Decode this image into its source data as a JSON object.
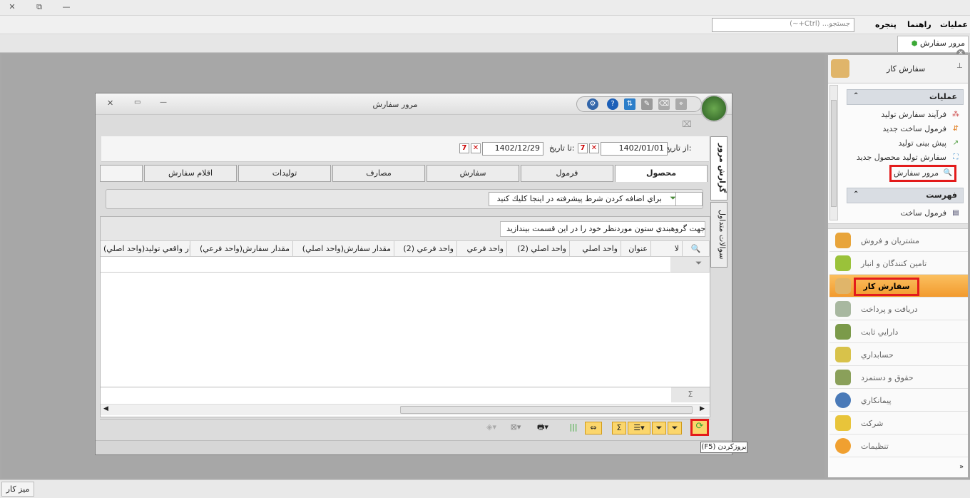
{
  "window": {
    "close": "✕",
    "restore": "⧉",
    "minimize": "—"
  },
  "menu": {
    "items": [
      "عملیات",
      "راهنما",
      "پنجره"
    ],
    "search_placeholder": "جستجو... (Ctrl+~)"
  },
  "doctab": {
    "label": "مرور سفارش"
  },
  "dialog": {
    "title": "مرور سفارش",
    "from_label": "از تاریخ:",
    "from_value": "1402/01/01",
    "to_label": "تا تاریخ:",
    "to_value": "1402/12/29",
    "tabs": [
      "محصول",
      "فرمول",
      "سفارش",
      "مصارف",
      "تولیدات",
      "اقلام سفارش"
    ],
    "vtabs": [
      "گزارش مرور",
      "سوالات متداول"
    ],
    "advanced_filter": "براي اضافه كردن شرط پيشرفته در اينجا كليك كنيد",
    "group_hint": "جهت گروهبندي ستون موردنظر خود را در این قسمت بيندازيد",
    "columns": [
      "لا",
      "عنوان",
      "واحد اصلي",
      "واحد اصلي (2)",
      "واحد فرعي",
      "واحد فرعي (2)",
      "مقدار سفارش(واحد اصلي)",
      "مقدار سفارش(واحد فرعي)",
      "مقدار واقعي توليد(واحد اصلي)"
    ],
    "sum_symbol": "Σ",
    "tooltip": "(F5) بروزكردن"
  },
  "rightpanel": {
    "title": "سفارش كار",
    "ops_header": "عملیات",
    "ops": [
      "فرآیند سفارش تولید",
      "فرمول ساخت جدید",
      "پیش بینی تولید",
      "سفارش تولید محصول جدید",
      "مرور سفارش"
    ],
    "list_header": "فهرست",
    "list": [
      "فرمول ساخت"
    ],
    "modules": [
      "مشتریان و فروش",
      "تامین کنندگان و انبار",
      "سفارش كار",
      "دریافت و پرداخت",
      "دارايي ثابت",
      "حسابداري",
      "حقوق و دستمزد",
      "پیمانکاري",
      "شرکت",
      "تنظیمات"
    ]
  },
  "bottom": {
    "desk": "میز کار"
  },
  "colors": {
    "accent": "#f29a2e",
    "highlight": "#e31b1b",
    "refresh": "#3aa835"
  }
}
